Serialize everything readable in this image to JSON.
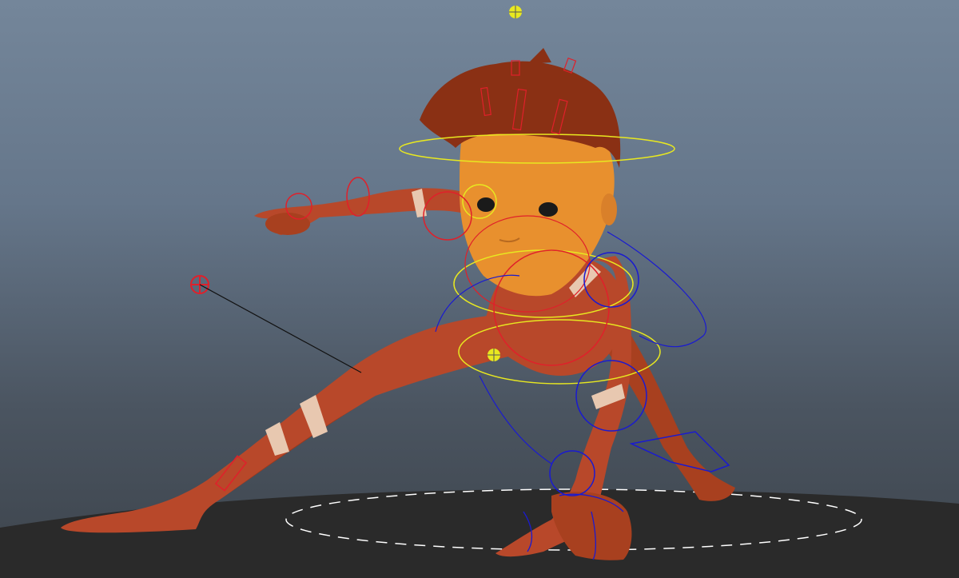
{
  "viewport": {
    "background_top": "#74869a",
    "background_bottom": "#3d444c",
    "ground_color": "#2a2a2a",
    "character": {
      "skin_color": "#b8482a",
      "face_color": "#e8902e",
      "hair_color": "#8a3014",
      "stripe_color": "#e8c8b0"
    },
    "rig_colors": {
      "fk_controls": "#e0202a",
      "ik_controls": "#1a1ad0",
      "center_controls": "#e8e820",
      "pole_vector_line": "#111111",
      "ground_circle": "#ffffff"
    }
  }
}
